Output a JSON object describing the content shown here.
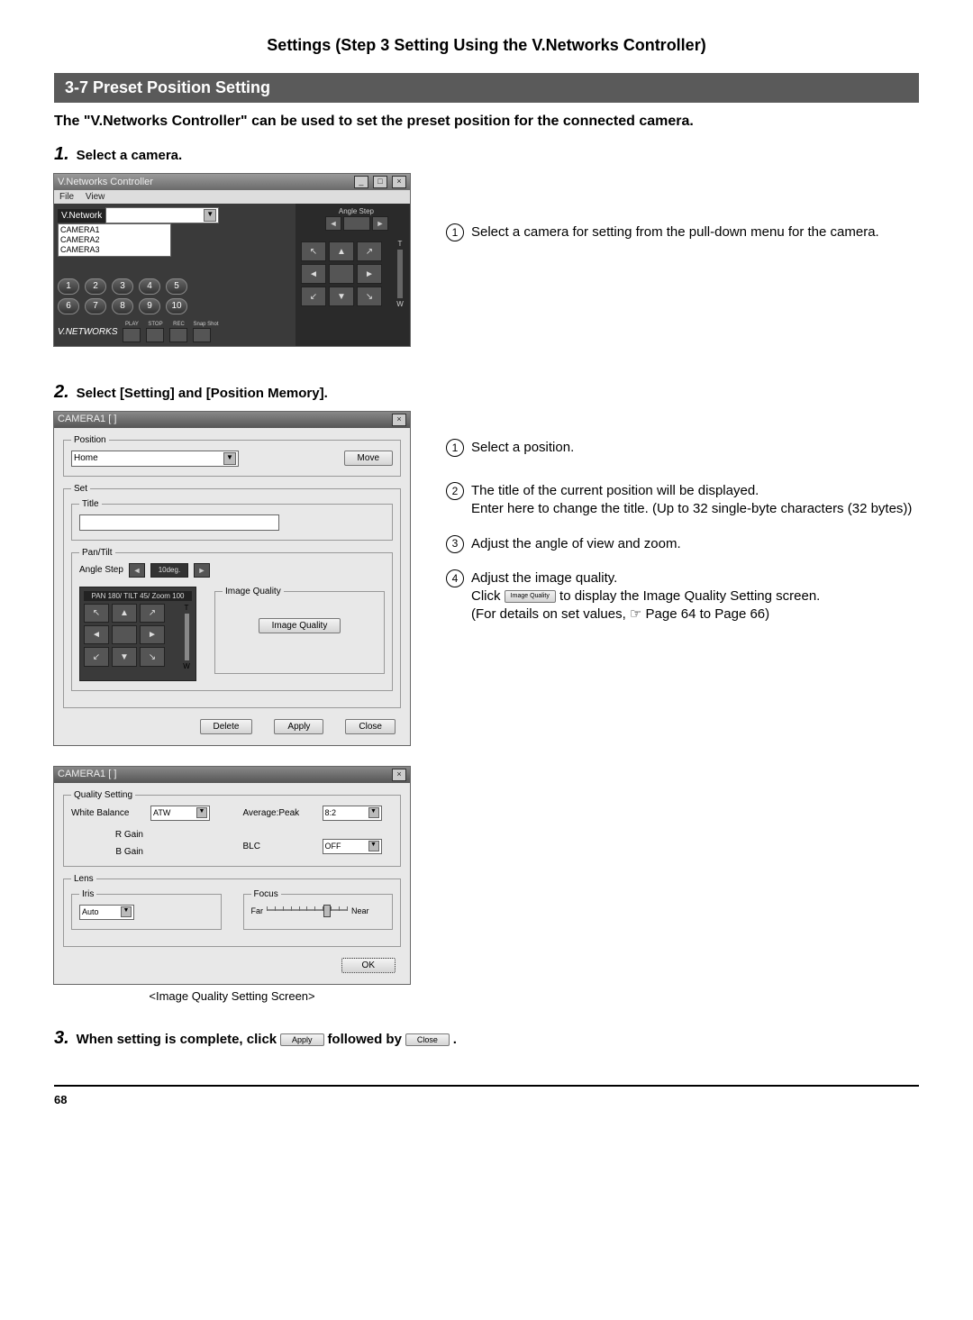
{
  "page_title": "Settings (Step 3 Setting Using the V.Networks Controller)",
  "section_header": "3-7 Preset Position Setting",
  "intro": "The \"V.Networks Controller\" can be used to set the preset position for the connected camera.",
  "step1_num": "1.",
  "step1_text": "Select a camera.",
  "step2_num": "2.",
  "step2_text": "Select [Setting] and [Position Memory].",
  "step3_num": "3.",
  "step3_text_a": "When setting is complete, click",
  "step3_text_b": "followed by",
  "step3_text_c": ".",
  "apply_inline": "Apply",
  "close_inline": "Close",
  "shot1": {
    "title": "V.Networks Controller",
    "menu_file": "File",
    "menu_view": "View",
    "vn_label": "V.Network",
    "camlist": [
      "CAMERA1",
      "CAMERA2",
      "CAMERA3"
    ],
    "nums": [
      "1",
      "2",
      "3",
      "4",
      "5",
      "6",
      "7",
      "8",
      "9",
      "10"
    ],
    "play": "PLAY",
    "stop": "STOP",
    "rec": "REC",
    "snap": "Snap Shot",
    "logo": "V.NETWORKS",
    "angle_step": "Angle Step",
    "t": "T",
    "w": "W"
  },
  "ann1_1": "Select a camera for setting from the pull-down menu for the camera.",
  "shot2": {
    "title": "CAMERA1  [ ]",
    "pos_legend": "Position",
    "pos_value": "Home",
    "move": "Move",
    "set_legend": "Set",
    "title_legend": "Title",
    "pt_legend": "Pan/Tilt",
    "angle_step": "Angle Step",
    "angle_val": "10deg.",
    "ptz_label": "PAN 180/ TILT 45/ Zoom 100",
    "iq_legend": "Image Quality",
    "iq_btn": "Image Quality",
    "delete": "Delete",
    "apply": "Apply",
    "close": "Close",
    "t": "T",
    "w": "W"
  },
  "ann2_1": "Select a position.",
  "ann2_2": "The title of the current position will be displayed.\nEnter here to change the title. (Up to 32 single-byte characters (32 bytes))",
  "ann2_3": "Adjust the angle of view and zoom.",
  "ann2_4a": "Adjust the image quality.",
  "ann2_4b_pre": "Click ",
  "ann2_4b_btn": "Image Quality",
  "ann2_4b_post": " to display the Image Quality Setting screen.",
  "ann2_4c": "(For details on set values, ☞ Page 64 to Page 66)",
  "shot3": {
    "title": "CAMERA1  [ ]",
    "qs_legend": "Quality Setting",
    "wb": "White Balance",
    "wb_val": "ATW",
    "rgain": "R Gain",
    "bgain": "B Gain",
    "avgpeak": "Average:Peak",
    "avgpeak_val": "8:2",
    "blc": "BLC",
    "blc_val": "OFF",
    "lens_legend": "Lens",
    "iris_legend": "Iris",
    "iris_val": "Auto",
    "focus_legend": "Focus",
    "far": "Far",
    "near": "Near",
    "ok": "OK"
  },
  "caption3": "<Image Quality Setting Screen>",
  "page_number": "68"
}
